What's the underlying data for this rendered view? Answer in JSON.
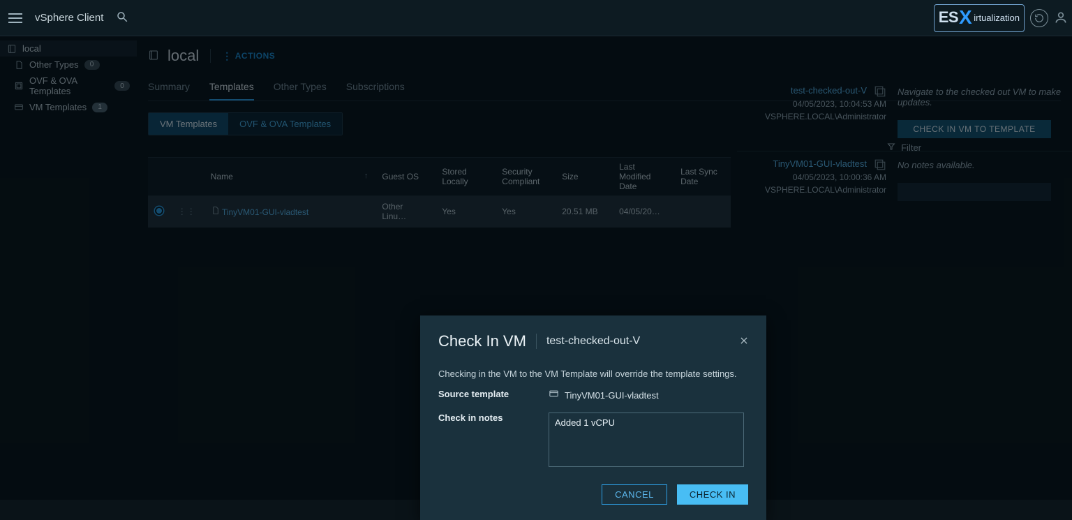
{
  "app": {
    "title": "vSphere Client"
  },
  "watermark": {
    "prefix": "ES",
    "suffix": "irtualization"
  },
  "sidebar": {
    "root": {
      "label": "local"
    },
    "items": [
      {
        "label": "Other Types",
        "count": "0"
      },
      {
        "label": "OVF & OVA Templates",
        "count": "0"
      },
      {
        "label": "VM Templates",
        "count": "1"
      }
    ]
  },
  "header": {
    "library": "local",
    "actions": "ACTIONS"
  },
  "tabs": {
    "items": [
      "Summary",
      "Templates",
      "Other Types",
      "Subscriptions"
    ],
    "activeIndex": 1
  },
  "subtabs": {
    "items": [
      "VM Templates",
      "OVF & OVA Templates"
    ],
    "activeIndex": 0
  },
  "filterLabel": "Filter",
  "table": {
    "columns": [
      "",
      "",
      "Name",
      "Guest OS",
      "Stored Locally",
      "Security Compliant",
      "Size",
      "Last Modified Date",
      "Last Sync Date"
    ],
    "rows": [
      {
        "name": "TinyVM01-GUI-vladtest",
        "guestOS": "Other Linu…",
        "storedLocally": "Yes",
        "securityCompliant": "Yes",
        "size": "20.51 MB",
        "lastModified": "04/05/20…",
        "lastSync": ""
      }
    ]
  },
  "cards": [
    {
      "title": "test-checked-out-V",
      "time": "04/05/2023, 10:04:53 AM",
      "user": "VSPHERE.LOCAL\\Administrator",
      "note": "Navigate to the checked out VM to make updates.",
      "button": "CHECK IN VM TO TEMPLATE"
    },
    {
      "title": "TinyVM01-GUI-vladtest",
      "time": "04/05/2023, 10:00:36 AM",
      "user": "VSPHERE.LOCAL\\Administrator",
      "note": "No notes available.",
      "button": ""
    }
  ],
  "modal": {
    "title": "Check In VM",
    "subtitle": "test-checked-out-V",
    "description": "Checking in the VM to the VM Template will override the template settings.",
    "sourceLabel": "Source template",
    "sourceValue": "TinyVM01-GUI-vladtest",
    "notesLabel": "Check in notes",
    "notesValue": "Added 1 vCPU",
    "cancel": "CANCEL",
    "confirm": "CHECK IN"
  }
}
